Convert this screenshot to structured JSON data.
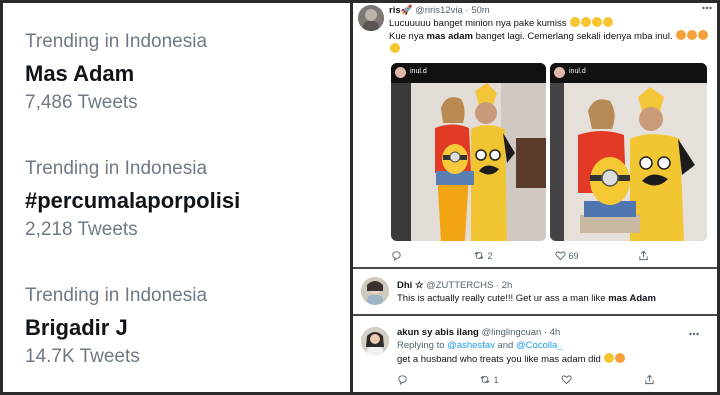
{
  "trends": [
    {
      "category": "Trending in Indonesia",
      "name": "Mas Adam",
      "count": "7,486 Tweets"
    },
    {
      "category": "Trending in Indonesia",
      "name": "#percumalaporpolisi",
      "count": "2,218 Tweets"
    },
    {
      "category": "Trending in Indonesia",
      "name": "Brigadir J",
      "count": "14.7K Tweets"
    }
  ],
  "tweet1": {
    "name": "ris🚀",
    "handle": "@riris12via",
    "time": "· 50m",
    "line1": "Lucuuuuu banget minion nya pake kumiss",
    "line2_pre": "Kue nya ",
    "line2_bold": "mas adam",
    "line2_post": " banget lagi. Cemerlang sekali idenya mba inul.",
    "media_user": "inul.d",
    "reply_count": "",
    "retweet_count": "2",
    "like_count": "69"
  },
  "tweet2": {
    "name": "Dhi ☆",
    "handle": "@ZUTTERCHS",
    "time": "· 2h",
    "text_pre": "This is actually really cute!!! Get ur ass a man like ",
    "text_bold": "mas Adam"
  },
  "tweet3": {
    "name": "akun sy abis ilang",
    "handle": "@linglingcuan",
    "time": "· 4h",
    "replying_label": "Replying to ",
    "reply_to_1": "@ashesfav",
    "reply_and": " and ",
    "reply_to_2": "@Cocolla_",
    "text": "get a husband who treats you like mas adam did",
    "retweet_count": "1"
  },
  "icons": {
    "reply": "reply-icon",
    "retweet": "retweet-icon",
    "like": "heart-icon",
    "share": "share-icon",
    "more": "more-icon"
  }
}
